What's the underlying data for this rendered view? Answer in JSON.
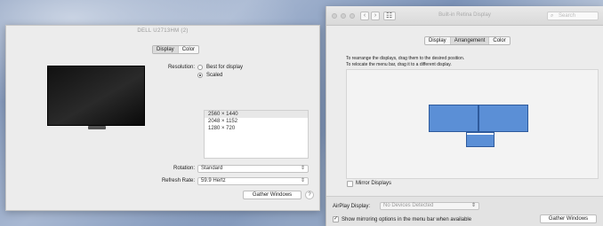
{
  "left_window": {
    "title": "DELL U2713HM (2)",
    "tabs": [
      {
        "label": "Display",
        "active": true
      },
      {
        "label": "Color",
        "active": false
      }
    ],
    "resolution_label": "Resolution:",
    "resolution_options": [
      "Best for display",
      "Scaled"
    ],
    "resolution_selected": "Scaled",
    "resolutions": [
      "2560 × 1440",
      "2048 × 1152",
      "1280 × 720"
    ],
    "resolution_list_selected": "2560 × 1440",
    "rotation_label": "Rotation:",
    "rotation_value": "Standard",
    "refresh_label": "Refresh Rate:",
    "refresh_value": "59.9 Hertz",
    "gather_button": "Gather Windows",
    "help_button": "?"
  },
  "right_window": {
    "title": "Built-in Retina Display",
    "search_placeholder": "Search",
    "tabs": [
      {
        "label": "Display",
        "active": false
      },
      {
        "label": "Arrangement",
        "active": true
      },
      {
        "label": "Color",
        "active": false
      }
    ],
    "instruction_1": "To rearrange the displays, drag them to the desired position.",
    "instruction_2": "To relocate the menu bar, drag it to a different display.",
    "mirror_label": "Mirror Displays",
    "mirror_checked": false,
    "airplay_label": "AirPlay Display:",
    "airplay_value": "No Devices Detected",
    "show_mirroring_label": "Show mirroring options in the menu bar when available",
    "show_mirroring_checked": true,
    "gather_button": "Gather Windows"
  }
}
